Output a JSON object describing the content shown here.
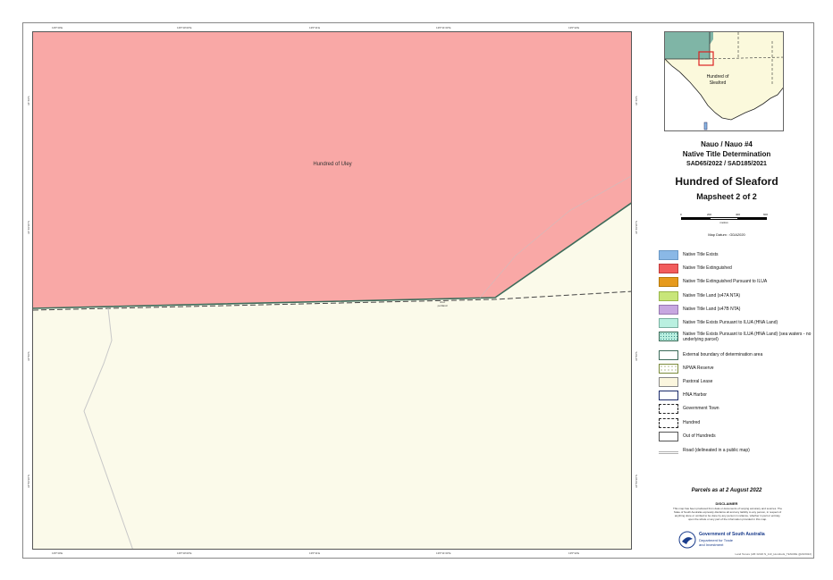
{
  "panel": {
    "title_line1": "Nauo / Nauo #4",
    "title_line2": "Native Title Determination",
    "title_line3": "SAD65/2022 / SAD185/2021",
    "hundred_title": "Hundred of Sleaford",
    "mapsheet": "Mapsheet 2 of 2",
    "scale_labels": [
      "0",
      "200",
      "400",
      "600"
    ],
    "scale_unit": "metres",
    "datum": "Map Datum : GDA2020",
    "parcels_note": "Parcels as at 2 August 2022",
    "disclaimer_title": "DISCLAIMER",
    "disclaimer_text": "This map has been produced from data or documents of varying accuracy and sources. The State of South Australia expressly disclaims all and any liability to any person, in respect of anything done or omitted to be done by any person in reliance, whether in part or entirely, upon the whole or any part of the information provided in this map.",
    "logo_line1": "Government of South Australia",
    "logo_line2": "Department for Trade",
    "logo_line3": "and Investment",
    "footer": "Land Tenure (AB: 02/20 N_113_Hundreds_TENURE @20/2022)"
  },
  "inset": {
    "label": "Hundred of Sleaford"
  },
  "map": {
    "label_uley": "Hundred of Uley",
    "label_small": "shot",
    "label_small2": "portland",
    "top_ticks": [
      "135°30'E",
      "135°30'30\"E",
      "135°31'E",
      "135°31'30\"E",
      "135°32'E"
    ],
    "bottom_ticks": [
      "135°30'E",
      "135°30'30\"E",
      "135°31'E",
      "135°31'30\"E",
      "135°32'E"
    ],
    "left_ticks": [
      "34°49'S",
      "34°49'30\"S",
      "34°50'S",
      "34°50'30\"S"
    ],
    "right_ticks": [
      "34°49'S",
      "34°49'30\"S",
      "34°50'S",
      "34°50'30\"S"
    ]
  },
  "legend": [
    {
      "label": "Native Title Exists",
      "color": "#8ab8e6"
    },
    {
      "label": "Native Title Extinguished",
      "color": "#f25c5c"
    },
    {
      "label": "Native Title Extinguished Pursuant to ILUA",
      "color": "#e69a1c"
    },
    {
      "label": "Native Title Land (s47A NTA)",
      "color": "#c8e67a"
    },
    {
      "label": "Native Title Land (s47B NTA)",
      "color": "#c7a7e0"
    },
    {
      "label": "Native Title Exists Pursuant to ILUA (HNA Land)",
      "color": "#b9f0e0"
    },
    {
      "label": "Native Title Exists Pursuant to ILUA (HNA Land) (sea waters - no underlying parcel)",
      "color": "#b9f0e0"
    },
    {
      "label": "External boundary of determination area",
      "color": "#ffffff"
    },
    {
      "label": "NPWA Reserve",
      "color": "#ffffff"
    },
    {
      "label": "Pastoral Lease",
      "color": "#fbf6de"
    },
    {
      "label": "HNA Harbor",
      "color": "#ffffff"
    },
    {
      "label": "Government Town",
      "color": "#ffffff"
    },
    {
      "label": "Hundred",
      "color": "#ffffff"
    },
    {
      "label": "Out of Hundreds",
      "color": "#ffffff"
    },
    {
      "label": "Road (delineated in a public map)",
      "color": "#ffffff"
    }
  ],
  "colors": {
    "extinguished_fill": "#f9a8a6",
    "pastoral_fill": "#fbfaea",
    "boundary": "#3d6b5a",
    "inset_sea": "#7fb5a6",
    "inset_land": "#fbf9dc"
  }
}
